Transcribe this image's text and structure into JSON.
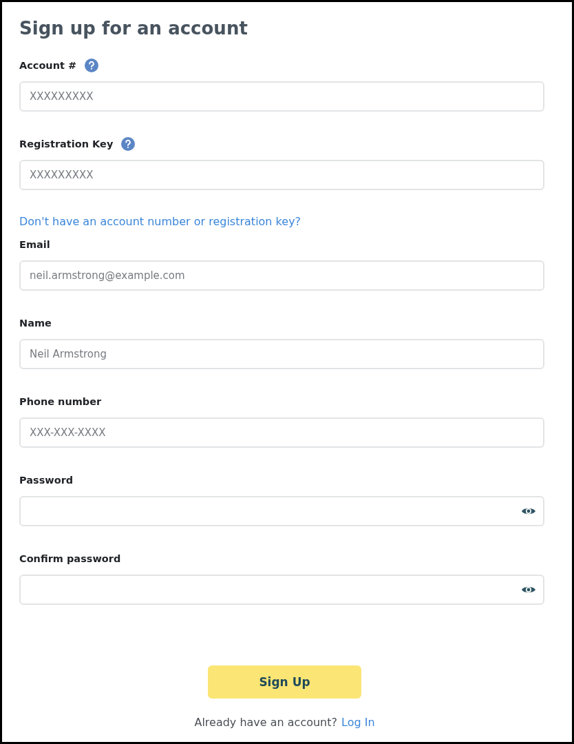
{
  "title": "Sign up for an account",
  "fields_top": [
    {
      "label": "Account #",
      "help": true,
      "kind": "text",
      "placeholder": "XXXXXXXXX"
    },
    {
      "label": "Registration Key",
      "help": true,
      "kind": "text",
      "placeholder": "XXXXXXXXX"
    }
  ],
  "help_link": "Don't have an account number or registration key?",
  "fields": [
    {
      "label": "Email",
      "help": false,
      "kind": "text",
      "placeholder": "neil.armstrong@example.com"
    },
    {
      "label": "Name",
      "help": false,
      "kind": "text",
      "placeholder": "Neil Armstrong"
    },
    {
      "label": "Phone number",
      "help": false,
      "kind": "text",
      "placeholder": "XXX-XXX-XXXX"
    },
    {
      "label": "Password",
      "help": false,
      "kind": "password"
    },
    {
      "label": "Confirm password",
      "help": false,
      "kind": "password"
    }
  ],
  "submit": "Sign Up",
  "footer": {
    "text": "Already have an account?",
    "link": "Log In"
  }
}
